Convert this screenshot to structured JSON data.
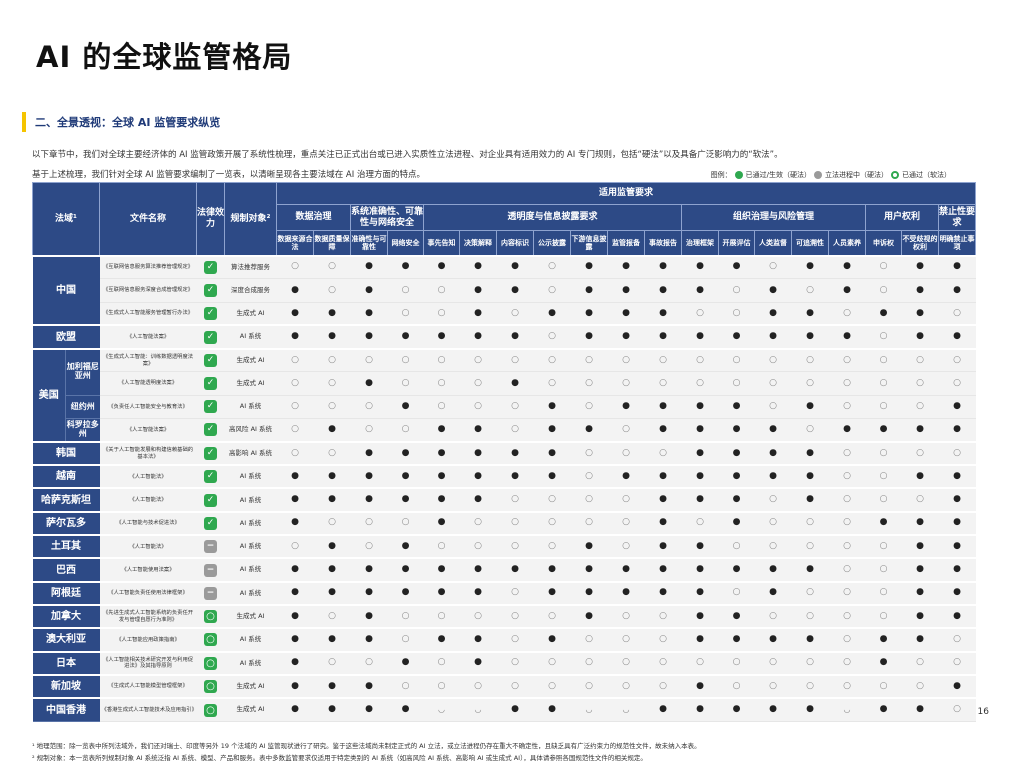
{
  "title": "AI 的全球监管格局",
  "section": "二、全景透视：全球 AI 监管要求纵览",
  "intro1": "以下章节中，我们对全球主要经济体的 AI 监管政策开展了系统性梳理，重点关注已正式出台或已进入实质性立法进程、对企业具有适用效力的 AI 专门规则，包括“硬法”以及具备广泛影响力的“软法”。",
  "intro2": "基于上述梳理，我们针对全球 AI 监管要求编制了一览表，以清晰呈现各主要法域在 AI 治理方面的特点。",
  "legend": {
    "label": "图例：",
    "passed": "已通过/生效（硬法）",
    "pending": "立法进程中（硬法）",
    "soft": "已通过（软法）"
  },
  "header": {
    "jurisdiction": "法域¹",
    "doc": "文件名称",
    "effect": "法律效力",
    "scope": "规制对象²",
    "applicable": "适用监管要求",
    "groups": [
      "数据治理",
      "系统准确性、可靠性与网络安全",
      "透明度与信息披露要求",
      "组织治理与风险管理",
      "用户权利",
      "禁止性要求"
    ],
    "cols": [
      "数据来源合法",
      "数据质量保障",
      "准确性与可靠性",
      "网络安全",
      "事先告知",
      "决策解释",
      "内容标识",
      "公示披露",
      "下游信息披露",
      "监管报备",
      "事故报告",
      "治理框架",
      "开展评估",
      "人类监督",
      "可追溯性",
      "人员素养",
      "申诉权",
      "不受歧视的权利",
      "明确禁止事项"
    ]
  },
  "symbols": {
    "full": "●",
    "empty": "○",
    "soft": "◡",
    "ok": "✓",
    "pending": "−",
    "softicon": "○"
  },
  "rows": [
    {
      "jur": "中国",
      "doc": "《互联网信息服务算法推荐管理规定》",
      "effect": "ok",
      "scope": "算法推荐服务",
      "m": "eefffffefffffeffeff"
    },
    {
      "doc": "《互联网信息服务深度合成管理规定》",
      "effect": "ok",
      "scope": "深度合成服务",
      "m": "fefeeffeffffefefefff"
    },
    {
      "doc": "《生成式人工智能服务管理暂行办法》",
      "effect": "ok",
      "scope": "生成式 AI",
      "m": "fffeefeffffeeffeff"
    },
    {
      "jur": "欧盟",
      "doc": "《人工智能法案》",
      "effect": "ok",
      "scope": "AI 系统",
      "m": "fffffffeffffffffeff"
    },
    {
      "jur": "美国",
      "sub": "加利福尼亚州",
      "doc": "《生成式人工智能：训练数据透明度法案》",
      "effect": "ok",
      "scope": "生成式 AI",
      "m": "eeeeeeeeeeeeeeeeeee"
    },
    {
      "doc": "《人工智能透明度法案》",
      "effect": "ok",
      "scope": "生成式 AI",
      "m": "eefeeefeeeeeeeeeeee"
    },
    {
      "sub": "纽约州",
      "doc": "《负责任人工智能安全与教育法》",
      "effect": "ok",
      "scope": "AI 系统",
      "m": "eeefeeefeffffefeeef"
    },
    {
      "sub": "科罗拉多州",
      "doc": "《人工智能法案》",
      "effect": "ok",
      "scope": "高风险 AI 系统",
      "m": "efeeffeffeffffeffff"
    },
    {
      "jur": "韩国",
      "doc": "《关于人工智能发展和构建信赖基础的基本法》",
      "effect": "ok",
      "scope": "高影响 AI 系统",
      "m": "eeffffffeeeffffeeee"
    },
    {
      "jur": "越南",
      "doc": "《人工智能法》",
      "effect": "ok",
      "scope": "AI 系统",
      "m": "ffffffffeffffffeeff"
    },
    {
      "jur": "哈萨克斯坦",
      "doc": "《人工智能法》",
      "effect": "ok",
      "scope": "AI 系统",
      "m": "ffffffeeeefffefeeef"
    },
    {
      "jur": "萨尔瓦多",
      "doc": "《人工智能与技术促进法》",
      "effect": "ok",
      "scope": "AI 系统",
      "m": "feeefeeeeefefeeefff"
    },
    {
      "jur": "土耳其",
      "doc": "《人工智能法》",
      "effect": "pe",
      "scope": "AI 系统",
      "m": "efefeeeefeffeeeeeff"
    },
    {
      "jur": "巴西",
      "doc": "《人工智能使用法案》",
      "effect": "pe",
      "scope": "AI 系统",
      "m": "fffffffffffffffeeff"
    },
    {
      "jur": "阿根廷",
      "doc": "《人工智能负责任使用法律框架》",
      "effect": "pe",
      "scope": "AI 系统",
      "m": "ffffffefffffefeeeff"
    },
    {
      "jur": "加拿大",
      "doc": "《先进生成式人工智能系统的负责任开发与管理自愿行为准则》",
      "effect": "so",
      "scope": "生成式 AI",
      "m": "fefeeeeefeeffeeeeff"
    },
    {
      "jur": "澳大利亚",
      "doc": "《人工智能应用政策指南》",
      "effect": "so",
      "scope": "AI 系统",
      "m": "fffeffefeeeffffeffe"
    },
    {
      "jur": "日本",
      "doc": "《人工智能相关技术研究开发与利用促进法》及其指导原则",
      "effect": "so",
      "scope": "AI 系统",
      "m": "feefefeeeeeeeeeefe"
    },
    {
      "jur": "新加坡",
      "doc": "《生成式人工智能模型管理框架》",
      "effect": "so",
      "scope": "生成式 AI",
      "m": "fffeeeeeeeefeeeeeef"
    },
    {
      "jur": "中国香港",
      "doc": "《香港生成式人工智能技术及应用指引》",
      "effect": "so",
      "scope": "生成式 AI",
      "m": "ffffssffssfffffsffe"
    }
  ],
  "foot1": "¹ 地理范围：除一览表中所列法域外，我们还对瑞士、印度等另外 19 个法域的 AI 监管现状进行了研究。鉴于这些法域尚未制定正式的 AI 立法，或立法进程仍存在重大不确定性，且缺乏具有广泛约束力的规范性文件，故未纳入本表。",
  "foot2": "² 规制对象：本一览表所列规制对象 AI 系统泛指 AI 系统、模型、产品和服务。表中多数监管要求仅适用于特定类别的 AI 系统（如高风险 AI 系统、高影响 AI 或生成式 AI），具体请参照各国规范性文件的相关规定。",
  "page": "16"
}
